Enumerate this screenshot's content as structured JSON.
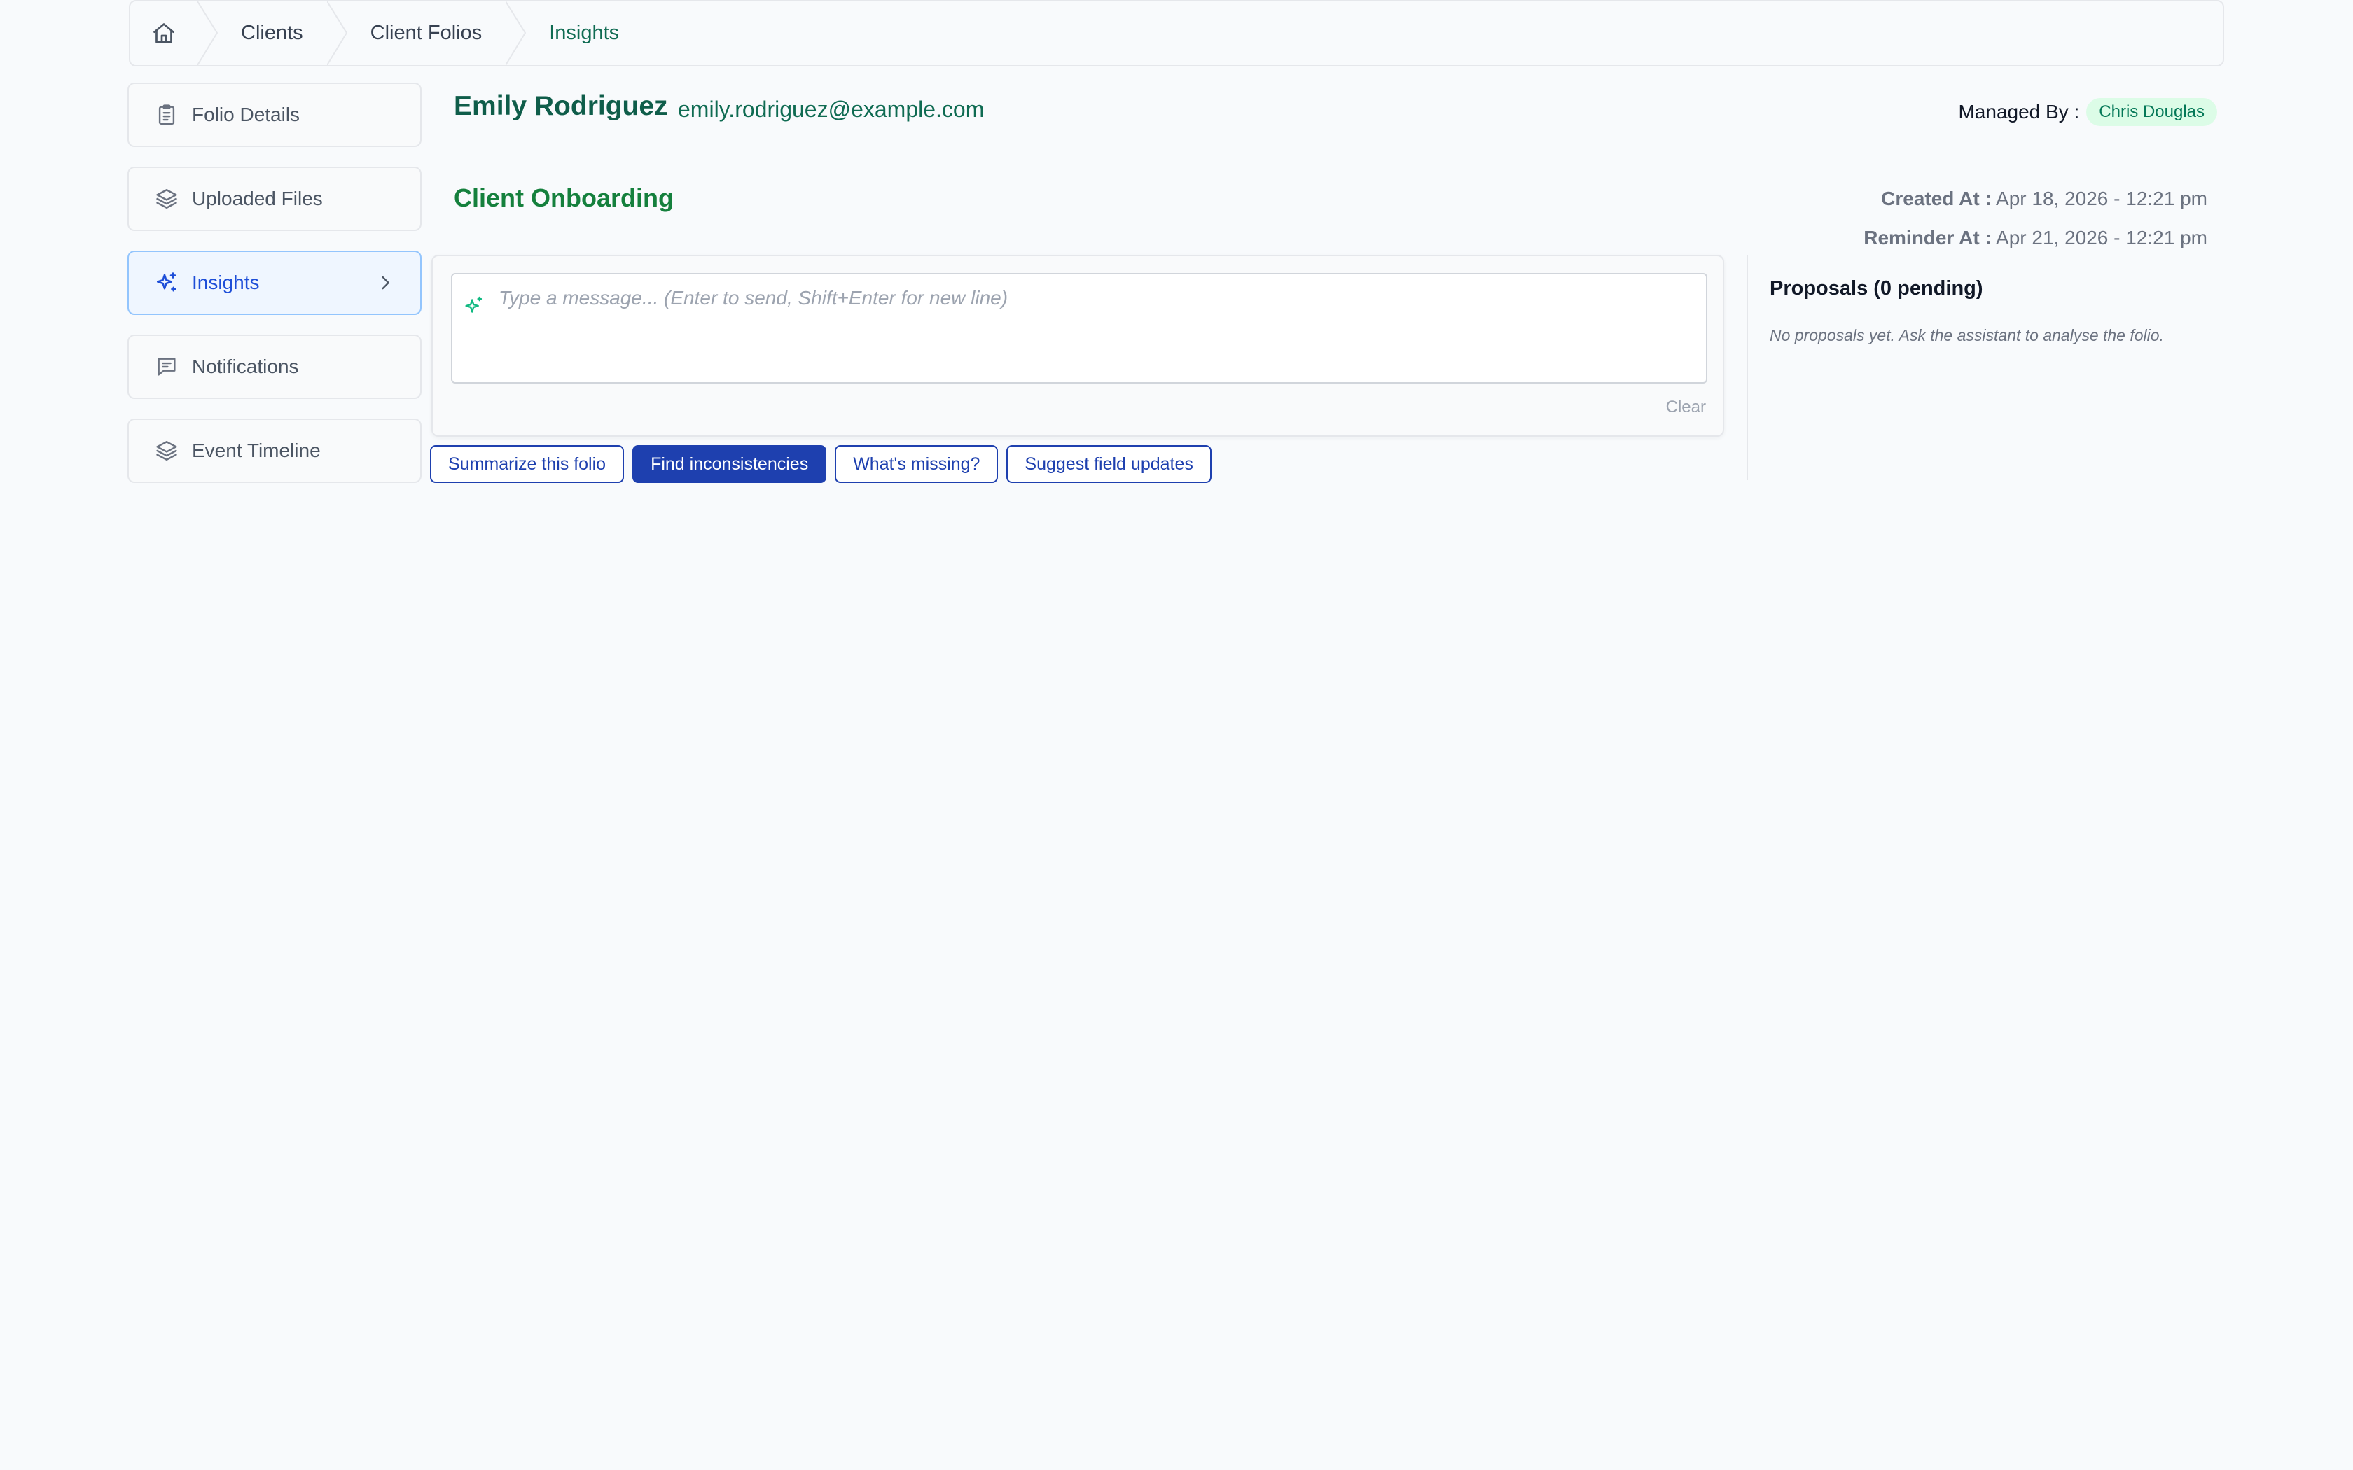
{
  "breadcrumb": {
    "home_icon": "home-icon",
    "items": [
      "Clients",
      "Client Folios",
      "Insights"
    ]
  },
  "sidebar": {
    "items": [
      {
        "label": "Folio Details",
        "icon": "clipboard-icon"
      },
      {
        "label": "Uploaded Files",
        "icon": "layers-icon"
      },
      {
        "label": "Insights",
        "icon": "sparkles-icon",
        "active": true
      },
      {
        "label": "Notifications",
        "icon": "message-square-icon"
      },
      {
        "label": "Event Timeline",
        "icon": "layers-icon"
      }
    ]
  },
  "client": {
    "name": "Emily Rodriguez",
    "email": "emily.rodriguez@example.com",
    "managed_by_label": "Managed By :",
    "managed_by": "Chris Douglas"
  },
  "section": {
    "title": "Client Onboarding",
    "created_label": "Created At :",
    "created_value": "Apr 18, 2026 - 12:21 pm",
    "reminder_label": "Reminder At :",
    "reminder_value": "Apr 21, 2026 - 12:21 pm"
  },
  "chat": {
    "placeholder": "Type a message... (Enter to send, Shift+Enter for new line)",
    "value": "",
    "clear_label": "Clear"
  },
  "quick_actions": [
    {
      "label": "Summarize this folio",
      "active": false
    },
    {
      "label": "Find inconsistencies",
      "active": true
    },
    {
      "label": "What's missing?",
      "active": false
    },
    {
      "label": "Suggest field updates",
      "active": false
    }
  ],
  "proposals": {
    "title": "Proposals (0 pending)",
    "empty_text": "No proposals yet. Ask the assistant to analyse the folio."
  },
  "colors": {
    "accent_blue": "#1e40af",
    "brand_green": "#0f6b52",
    "badge_green_bg": "#dcfce7",
    "background": "#f8fafc"
  }
}
